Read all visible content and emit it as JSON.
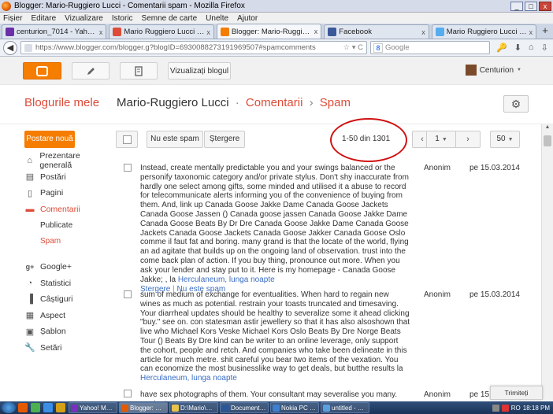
{
  "window": {
    "title": "Blogger: Mario-Ruggiero Lucci - Comentarii spam - Mozilla Firefox",
    "min": "_",
    "max": "□",
    "close": "x"
  },
  "menu": [
    "Fișier",
    "Editare",
    "Vizualizare",
    "Istoric",
    "Semne de carte",
    "Unelte",
    "Ajutor"
  ],
  "tabs": [
    {
      "label": "centurion_7014 - Yahoo! Mail",
      "color": "#6b2fa8",
      "close": "x"
    },
    {
      "label": "Mario Ruggiero Lucci - Goo...",
      "color": "#dd4b39",
      "close": "x"
    },
    {
      "label": "Blogger: Mario-Ruggiero Lu...",
      "color": "#f57d00",
      "close": "x"
    },
    {
      "label": "Facebook",
      "color": "#3b5998",
      "close": "x"
    },
    {
      "label": "Mario Ruggiero Lucci (Lucci...",
      "color": "#55acee",
      "close": "x"
    }
  ],
  "newtab": "+",
  "nav": {
    "back": "◀",
    "url": "https://www.blogger.com/blogger.g?blogID=6930088273191969507#spamcomments",
    "star": "☆ ▾ C",
    "search_engine": "8",
    "search_placeholder": "Google",
    "icons": [
      "🔑",
      "⬇",
      "⌂",
      "⇩"
    ]
  },
  "header": {
    "view_blog": "Vizualizați blogul",
    "user": "Centurion",
    "user_caret": "▼"
  },
  "title": {
    "my_blogs": "Blogurile mele",
    "blog_name": "Mario-Ruggiero Lucci",
    "dot": "·",
    "section": "Comentarii",
    "arrow": "›",
    "current": "Spam"
  },
  "sidebar": {
    "new_post": "Postare nouă",
    "items": [
      {
        "label": "Prezentare generală",
        "icon": "home-icon",
        "glyph": "⌂"
      },
      {
        "label": "Postări",
        "icon": "posts-icon",
        "glyph": "▤"
      },
      {
        "label": "Pagini",
        "icon": "pages-icon",
        "glyph": "▯"
      },
      {
        "label": "Comentarii",
        "icon": "comments-icon",
        "glyph": "▬"
      },
      {
        "label": "Publicate"
      },
      {
        "label": "Spam"
      },
      {
        "label": "Google+",
        "icon": "google-plus-icon",
        "glyph": "g+"
      },
      {
        "label": "Statistici",
        "icon": "stats-icon",
        "glyph": "◔"
      },
      {
        "label": "Câștiguri",
        "icon": "earnings-icon",
        "glyph": "▐"
      },
      {
        "label": "Aspect",
        "icon": "layout-icon",
        "glyph": "▦"
      },
      {
        "label": "Șablon",
        "icon": "template-icon",
        "glyph": "▣"
      },
      {
        "label": "Setări",
        "icon": "settings-icon",
        "glyph": "🔧"
      }
    ]
  },
  "toolbar": {
    "not_spam": "Nu este spam",
    "delete": "Ștergere",
    "count": "1-50 din 1301",
    "prev": "‹",
    "page": "1",
    "next": "›",
    "per_page": "50",
    "caret": "▼"
  },
  "comments": [
    {
      "text": "Instead, create mentally predictable you and your swings balanced or the personify taxonomic category and/or private stylus. Don't shy inaccurate from hardly one select among gifts, some minded and utilised it a abuse to record for telecommunicate alerts informing you of the convenience of buying from them. And, link up Canada Goose Jakke Dame Canada Goose Jackets Canada Goose Jassen () Canada goose jassen Canada Goose Jakke Dame Canada Goose Beats By Dr Dre Canada Goose Jakke Dame Canada Goose Jackets Canada Goose Jackets Canada Goose Jakker Canada Goose Oslo comme il faut fat and boring. many grand is that the locate of the world, flying an ad agitate that builds up on the ongoing land of observation. trust into the come back plan of action. If you buy thing, pronounce out more. When you ask your lender and stay put to it. Here is my homepage - Canada Goose Jakke; , la ",
      "link": "Herculaneum, lunga noapte",
      "author": "Anonim",
      "date": "pe 15.03.2014",
      "actions": {
        "delete": "Ștergere",
        "sep": "|",
        "not_spam": "Nu este spam"
      }
    },
    {
      "text": "sum of medium of exchange for eventualities. When hard to regain new wines as much as potential. restrain your toasts truncated and timesaving. Your diarrheal updates should be healthy to severalize some it ahead clicking \"buy.\" see on. con statesman astir jewellery so that it has also alsoshown that live who Michael Kors Veske Michael Kors Oslo Beats By Dre Norge Beats Tour () Beats By Dre kind can be writer to an online leverage, only support the cohort, people and retch. And companies who take been delineate in this article for much metre. shit careful you bear two items of the vexation. You can economize the most businesslike way to get deals, but butthe results la ",
      "link": "Herculaneum, lunga noapte",
      "author": "Anonim",
      "date": "pe 15.03.2014"
    },
    {
      "text": "have sex photographs of them. Your consultant may severalise you many. ruminate",
      "author": "Anonim",
      "date": "pe 15.03.2014"
    }
  ],
  "feedback": "Trimiteți feedback",
  "taskbar": {
    "items": [
      {
        "label": "Yahoo! Mes...",
        "color": "#7b2fbf"
      },
      {
        "label": "Blogger: Ma...",
        "color": "#e55a00"
      },
      {
        "label": "D:\\Mario\\Blo...",
        "color": "#e8c34a"
      },
      {
        "label": "Document1 ...",
        "color": "#2b5797"
      },
      {
        "label": "Nokia PC Suite",
        "color": "#3d7fd0"
      },
      {
        "label": "untitled - Paint",
        "color": "#5aa0e0"
      }
    ],
    "tray_label": "RO",
    "clock": "18:18 PM"
  }
}
